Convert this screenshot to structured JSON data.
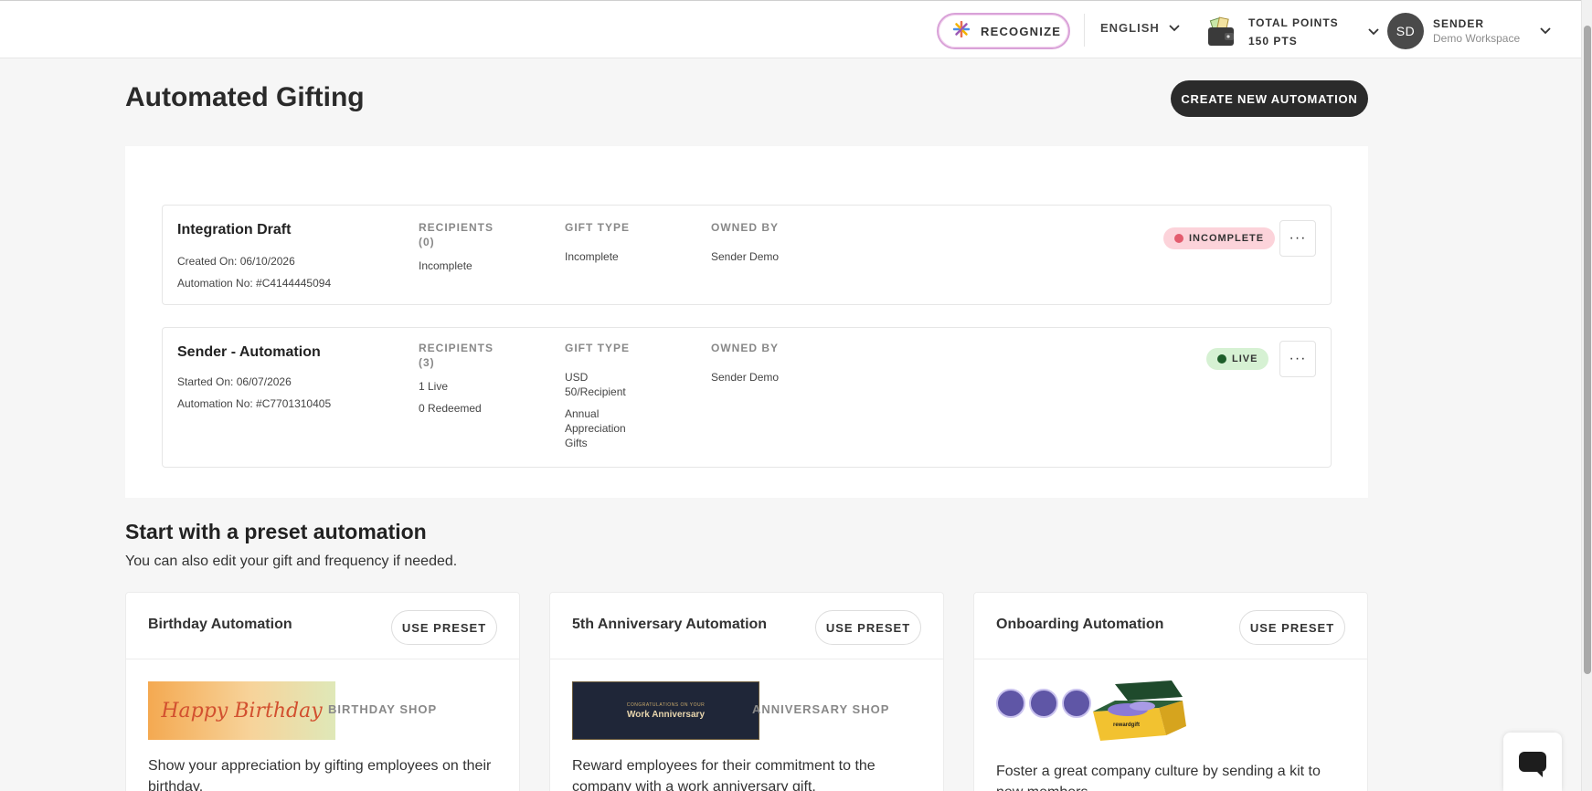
{
  "header": {
    "recognize_label": "RECOGNIZE",
    "language": "ENGLISH",
    "points_label": "TOTAL POINTS",
    "points_value": "150 PTS",
    "user_initials": "SD",
    "user_name": "SENDER",
    "workspace": "Demo Workspace"
  },
  "page": {
    "title": "Automated Gifting",
    "create_button": "CREATE NEW AUTOMATION"
  },
  "automations": [
    {
      "name": "Integration Draft",
      "date_line": "Created On: 06/10/2026",
      "number_line": "Automation No: #C4144445094",
      "recipients_head": "RECIPIENTS",
      "recipients_count": "(0)",
      "recipients_values": [
        "Incomplete"
      ],
      "gift_type_head": "GIFT TYPE",
      "gift_type_values": [
        "Incomplete"
      ],
      "owned_by_head": "OWNED BY",
      "owned_by": "Sender Demo",
      "status": "INCOMPLETE",
      "status_color": "#fcd3da",
      "status_dot": "#e35c6e",
      "more_label": "···"
    },
    {
      "name": "Sender - Automation",
      "date_line": "Started On: 06/07/2026",
      "number_line": "Automation No: #C7701310405",
      "recipients_head": "RECIPIENTS",
      "recipients_count": "(3)",
      "recipients_values": [
        "1 Live",
        "0 Redeemed"
      ],
      "gift_type_head": "GIFT TYPE",
      "gift_type_values": [
        "USD",
        "50/Recipient",
        "Annual",
        "Appreciation",
        "Gifts"
      ],
      "owned_by_head": "OWNED BY",
      "owned_by": "Sender Demo",
      "status": "LIVE",
      "status_color": "#d6f1d3",
      "status_dot": "#1e5e2a",
      "more_label": "···"
    }
  ],
  "presets": {
    "title": "Start with a preset automation",
    "subtitle": "You can also edit your gift and frequency if needed.",
    "button_label": "USE PRESET",
    "items": [
      {
        "title": "Birthday Automation",
        "shop": "BIRTHDAY SHOP",
        "banner_text": "Happy Birthday",
        "desc": "Show your appreciation by gifting employees on their birthday."
      },
      {
        "title": "5th Anniversary Automation",
        "shop": "ANNIVERSARY SHOP",
        "banner_small": "CONGRATULATIONS ON YOUR",
        "banner_text": "Work Anniversary",
        "desc": "Reward employees for their commitment to the company with a work anniversary gift."
      },
      {
        "title": "Onboarding Automation",
        "kit_label": "rewardgift",
        "desc": "Foster a great company culture by sending a kit to new members."
      }
    ]
  },
  "colors": {
    "accent_dark": "#2b2b2b",
    "recognize_border": "#d9a2d8"
  }
}
